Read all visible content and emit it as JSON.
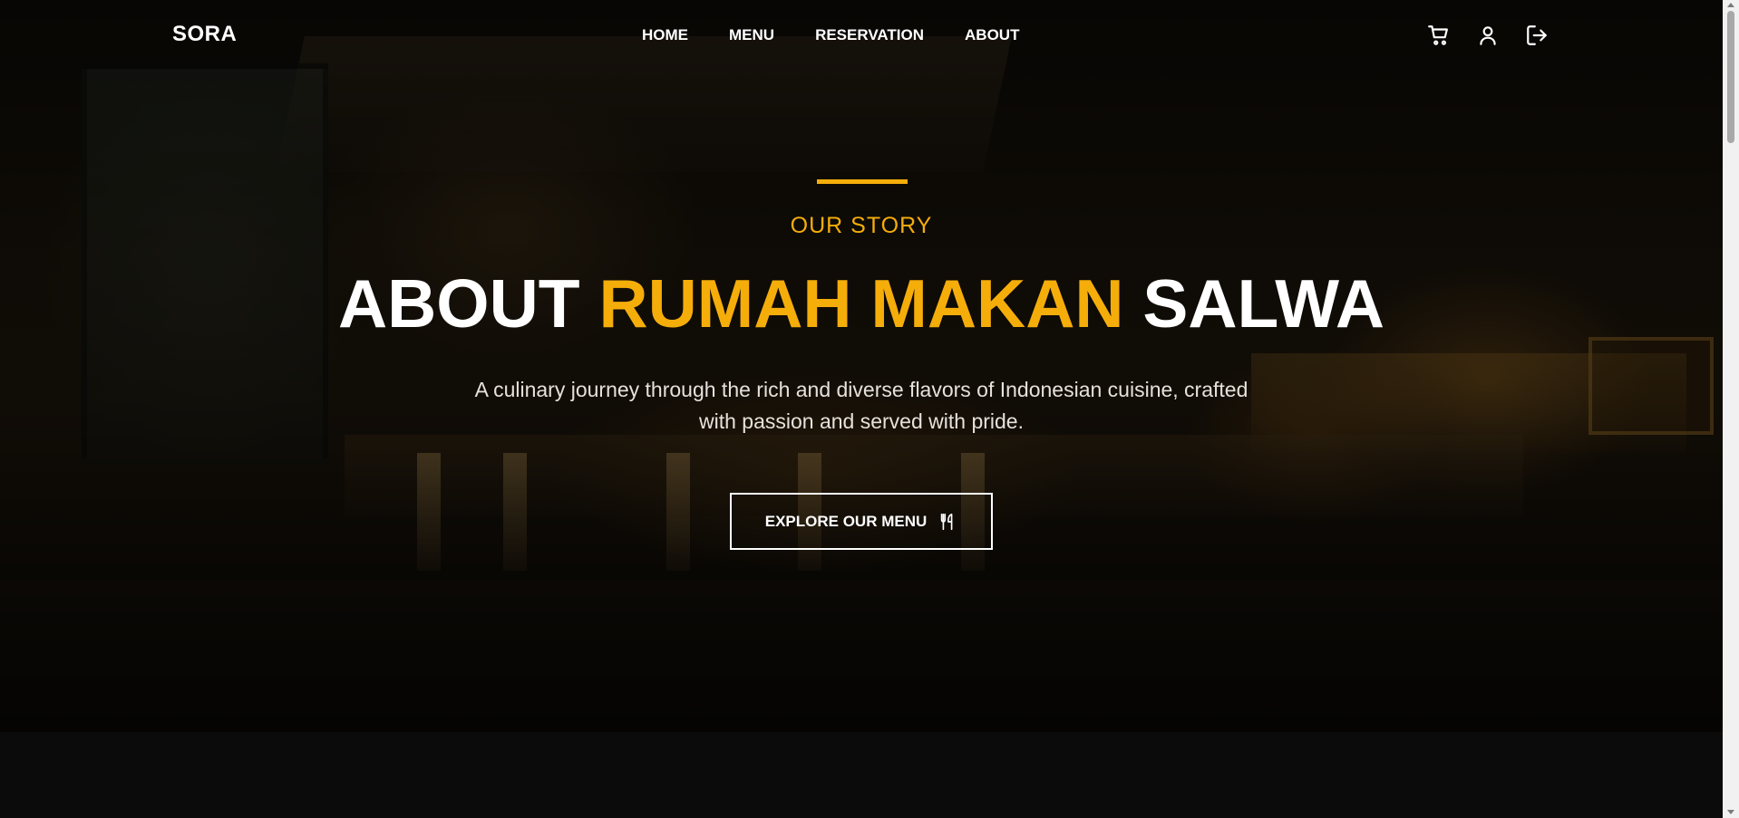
{
  "brand": {
    "logo": "SORA"
  },
  "nav": {
    "links": [
      {
        "label": "HOME"
      },
      {
        "label": "MENU"
      },
      {
        "label": "RESERVATION"
      },
      {
        "label": "ABOUT"
      }
    ],
    "icons": [
      "cart-icon",
      "user-icon",
      "logout-icon"
    ]
  },
  "hero": {
    "eyebrow": "OUR STORY",
    "title_part1": "ABOUT ",
    "title_highlight": "RUMAH MAKAN",
    "title_part2": " SALWA",
    "subtitle_line1": "A culinary journey through the rich and diverse flavors of Indonesian cuisine, crafted",
    "subtitle_line2": "with passion and served with pride.",
    "cta_label": "EXPLORE OUR MENU",
    "cta_icon": "utensils-icon"
  },
  "colors": {
    "accent": "#f5ad0a",
    "text": "#ffffff",
    "background": "#0b0b0b"
  }
}
